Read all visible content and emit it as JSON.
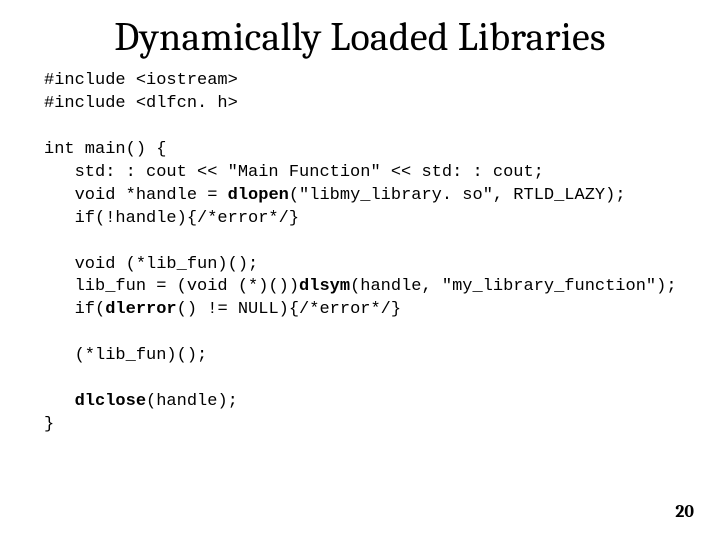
{
  "slide": {
    "title": "Dynamically Loaded Libraries",
    "page_number": "20",
    "code": {
      "l01": "#include <iostream>",
      "l02": "#include <dlfcn. h>",
      "l03": "",
      "l04": "int main() {",
      "l05": "   std: : cout << \"Main Function\" << std: : cout;",
      "l06a": "   void *handle = ",
      "l06b": "dlopen",
      "l06c": "(\"libmy_library. so\", RTLD_LAZY);",
      "l07": "   if(!handle){/*error*/}",
      "l08": "",
      "l09": "   void (*lib_fun)();",
      "l10a": "   lib_fun = (void (*)())",
      "l10b": "dlsym",
      "l10c": "(handle, \"my_library_function\");",
      "l11a": "   if(",
      "l11b": "dlerror",
      "l11c": "() != NULL){/*error*/}",
      "l12": "",
      "l13": "   (*lib_fun)();",
      "l14": "",
      "l15a": "   ",
      "l15b": "dlclose",
      "l15c": "(handle);",
      "l16": "}"
    }
  }
}
